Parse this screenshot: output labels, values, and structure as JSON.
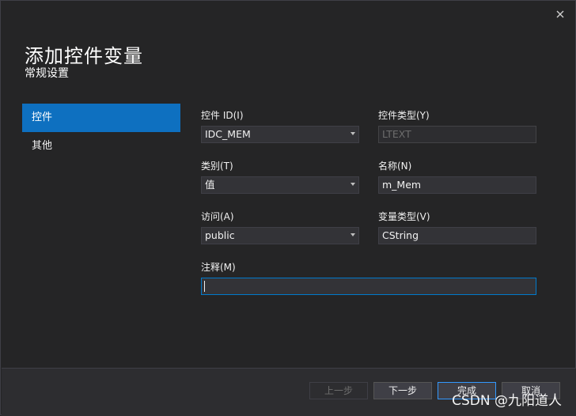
{
  "dialog": {
    "title": "添加控件变量",
    "subtitle": "常规设置",
    "close_icon": "close-icon"
  },
  "nav": {
    "items": [
      {
        "label": "控件",
        "active": true
      },
      {
        "label": "其他",
        "active": false
      }
    ]
  },
  "form": {
    "control_id": {
      "label": "控件 ID(I)",
      "value": "IDC_MEM"
    },
    "control_type": {
      "label": "控件类型(Y)",
      "value": "LTEXT"
    },
    "category": {
      "label": "类别(T)",
      "value": "值"
    },
    "name": {
      "label": "名称(N)",
      "value": "m_Mem"
    },
    "access": {
      "label": "访问(A)",
      "value": "public"
    },
    "var_type": {
      "label": "变量类型(V)",
      "value": "CString"
    },
    "comment": {
      "label": "注释(M)",
      "value": ""
    }
  },
  "footer": {
    "prev_label": "上一步",
    "next_label": "下一步",
    "finish_label": "完成",
    "cancel_label": "取消"
  },
  "watermark": "CSDN @九阳道人",
  "colors": {
    "background": "#252526",
    "accent": "#0e70c0",
    "focus_border": "#007acc"
  }
}
